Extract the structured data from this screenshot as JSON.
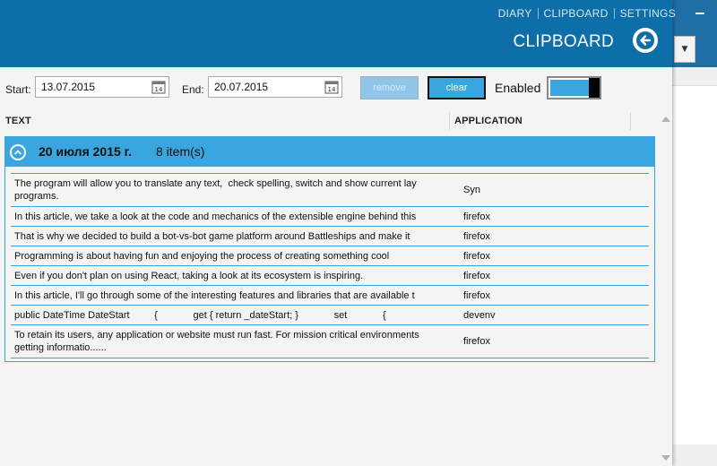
{
  "header": {
    "nav": [
      "DIARY",
      "CLIPBOARD",
      "SETTINGS"
    ],
    "title": "CLIPBOARD",
    "back_icon": "arrow-left-icon",
    "accent_color": "#0e6ea8"
  },
  "filters": {
    "start_label": "Start:",
    "start_value": "13.07.2015",
    "end_label": "End:",
    "end_value": "20.07.2015",
    "calendar_icon_text": "14",
    "remove_label": "remove",
    "clear_label": "clear",
    "enabled_label": "Enabled",
    "enabled_on": true
  },
  "columns": [
    "TEXT",
    "APPLICATION"
  ],
  "group": {
    "date": "20 июля 2015 г.",
    "count": "8 item(s)",
    "highlight_color": "#3aa6e0"
  },
  "rows": [
    {
      "text": "The program will allow you to translate any text,  check spelling, switch and show current lay\nprograms.",
      "app": "Syn"
    },
    {
      "text": "In this article, we take a look at the code and mechanics of the extensible engine behind this",
      "app": "firefox"
    },
    {
      "text": "That is why we decided to build a bot-vs-bot game platform around Battleships and make it",
      "app": "firefox"
    },
    {
      "text": "Programming is about having fun and enjoying the process of creating something cool",
      "app": "firefox"
    },
    {
      "text": "Even if you don't plan on using React, taking a look at its ecosystem is inspiring.",
      "app": "firefox"
    },
    {
      "text": "In this article, I'll go through some of the interesting features and libraries that are available t",
      "app": "firefox"
    },
    {
      "text": "public DateTime DateStart         {             get { return _dateStart; }             set             {",
      "app": "devenv"
    },
    {
      "text": "To retain its users, any application or website must run fast. For mission critical environments\ngetting informatio......",
      "app": "firefox"
    }
  ]
}
